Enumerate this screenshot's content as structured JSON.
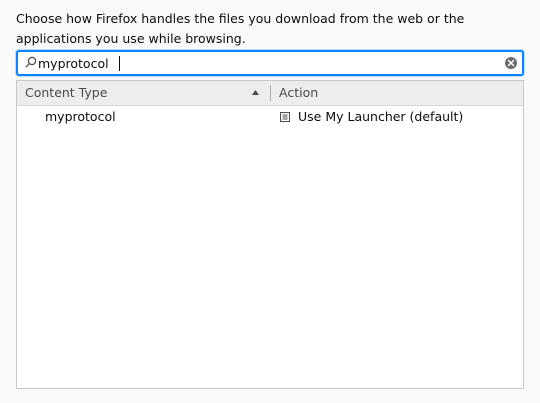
{
  "description": "Choose how Firefox handles the files you download from the web or the applications you use while browsing.",
  "search": {
    "value": "myprotocol",
    "icon": "search-icon"
  },
  "table": {
    "columns": {
      "content_type": "Content Type",
      "action": "Action"
    },
    "sort": "ascending",
    "rows": [
      {
        "type": "myprotocol",
        "action": "Use My Launcher (default)",
        "action_icon": "application-icon"
      }
    ]
  },
  "colors": {
    "focus_ring": "#0a84ff",
    "header_bg": "#ededf0"
  }
}
